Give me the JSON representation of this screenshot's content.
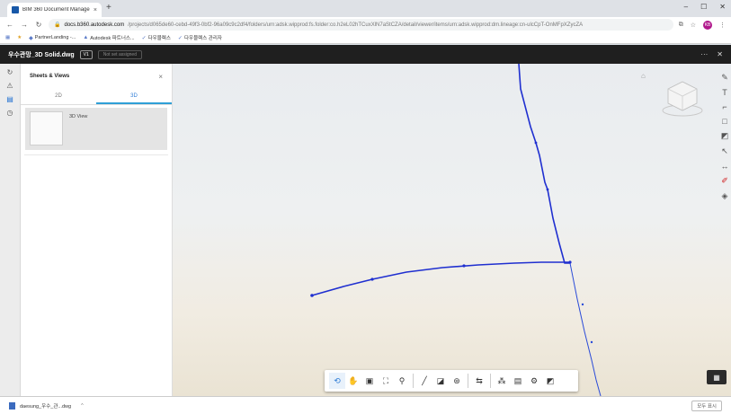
{
  "browser": {
    "tab_title": "BIM 360 Document Managem",
    "tab_close": "×",
    "new_tab": "+",
    "url_host": "docs.b360.autodesk.com",
    "url_path": "/projects/d065de60-cebd-49f3-0bf2-96a09c9c2df4/folders/urn:adsk.wipprod:fs.folder:co.h2eL02hTCuxXlN7aStCZA/detail/viewer/items/urn:adsk.wipprod:dm.lineage:cn-ulcCpT-OnMFpXZycZA",
    "bookmarks": [
      "PartnerLanding -...",
      "Autodesk 파트너스...",
      "다우블렉스",
      "다우블렉스 관리자"
    ],
    "window_controls": [
      "–",
      "☐",
      "✕"
    ]
  },
  "app": {
    "title": "우수관망_3D Solid.dwg",
    "version": "V1",
    "assignment": "Not set assigned",
    "more": "···",
    "close": "✕"
  },
  "panel": {
    "title": "Sheets & Views",
    "close": "×",
    "tabs": [
      "2D",
      "3D"
    ],
    "active_tab": "3D",
    "items": [
      {
        "label": "3D View"
      }
    ]
  },
  "download": {
    "filename": "daesung_우수_관...dwg",
    "show_all": "모두 표시"
  },
  "colors": {
    "pipe": "#1f2fd0",
    "accent": "#2f7cd6"
  },
  "icons": {
    "rail": [
      "history-icon",
      "warning-icon",
      "sheets-icon",
      "clock-icon"
    ],
    "toolbar": [
      "orbit-icon",
      "pan-icon",
      "camera-icon",
      "fit-view-icon",
      "walk-icon",
      "measure-icon",
      "section-icon",
      "explode-icon",
      "compare-icon",
      "model-browser-icon",
      "properties-icon",
      "settings-icon",
      "fullscreen-icon"
    ],
    "markup": [
      "text-markup-icon",
      "text-icon",
      "callout-icon",
      "rectangle-icon",
      "cloud-icon",
      "arrow-icon",
      "dimension-icon",
      "pen-icon",
      "fill-icon"
    ]
  }
}
